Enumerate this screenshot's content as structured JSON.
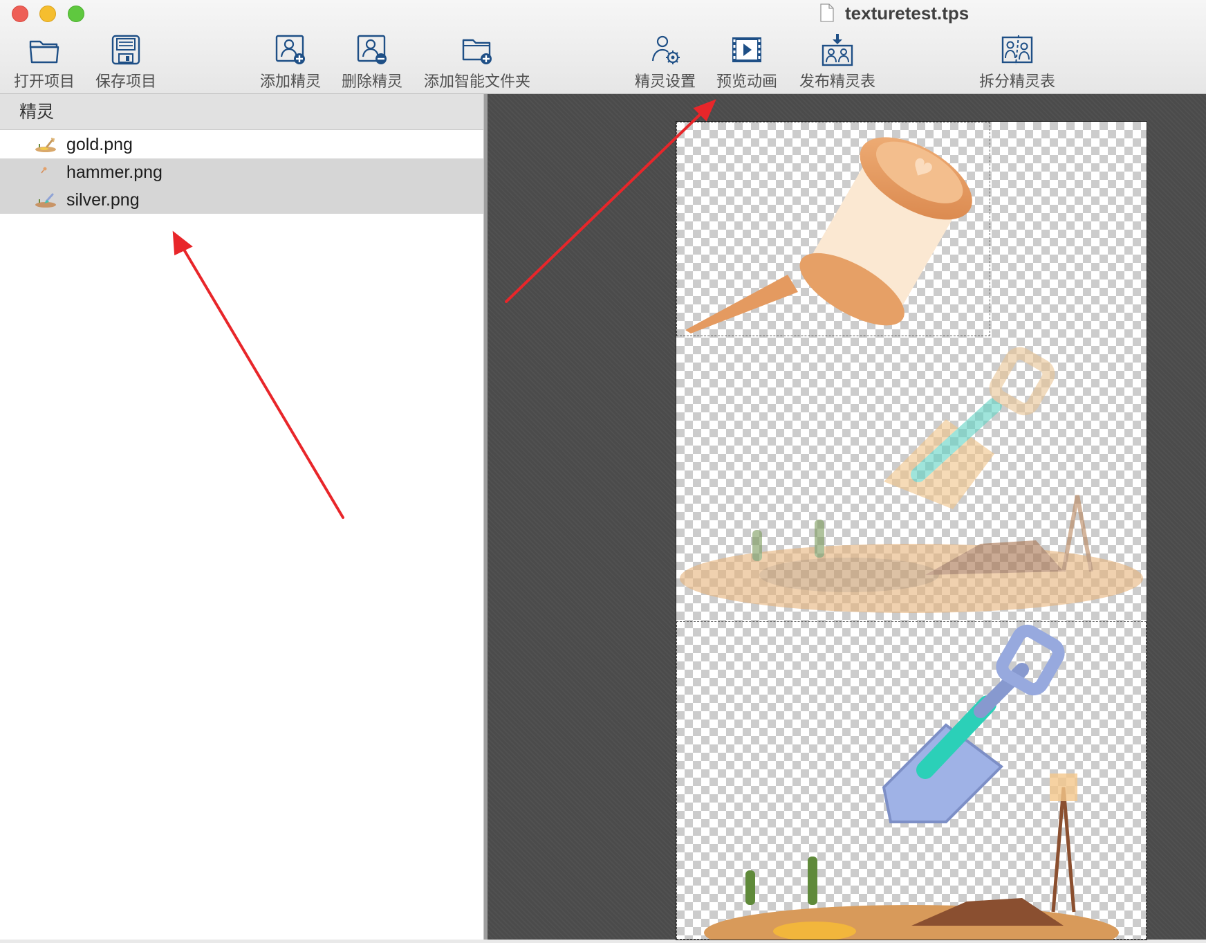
{
  "window": {
    "title": "texturetest.tps"
  },
  "toolbar": {
    "open_label": "打开项目",
    "save_label": "保存项目",
    "add_sprite_label": "添加精灵",
    "remove_sprite_label": "删除精灵",
    "add_smart_folder_label": "添加智能文件夹",
    "sprite_settings_label": "精灵设置",
    "preview_anim_label": "预览动画",
    "publish_label": "发布精灵表",
    "split_label": "拆分精灵表"
  },
  "sprites_panel": {
    "header": "精灵",
    "items": [
      {
        "name": "gold.png",
        "selected": false,
        "icon": "gold-thumb"
      },
      {
        "name": "hammer.png",
        "selected": true,
        "icon": "hammer-thumb"
      },
      {
        "name": "silver.png",
        "selected": true,
        "icon": "silver-thumb"
      }
    ]
  },
  "canvas": {
    "sprites": [
      {
        "icon": "hammer-sprite"
      },
      {
        "icon": "gold-shovel-sprite"
      },
      {
        "icon": "silver-shovel-sprite"
      }
    ]
  },
  "colors": {
    "annotation_arrow": "#e8262a",
    "selection_row": "#d6d6d6",
    "toolbar_icon": "#1e4f86"
  }
}
